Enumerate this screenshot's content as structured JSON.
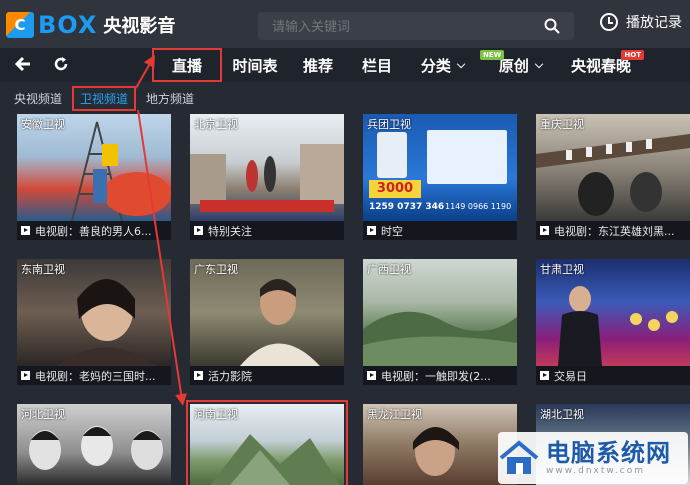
{
  "app": {
    "logo_mark": "C",
    "logo_box": "BOX",
    "logo_name": "央视影音"
  },
  "search": {
    "placeholder": "请输入关键词",
    "icon": "search-icon"
  },
  "history": {
    "label": "播放记录",
    "icon": "clock-icon"
  },
  "nav": {
    "back_icon": "back-arrow-icon",
    "refresh_icon": "refresh-icon",
    "items": [
      {
        "label": "直播",
        "active": true
      },
      {
        "label": "时间表"
      },
      {
        "label": "推荐"
      },
      {
        "label": "栏目"
      },
      {
        "label": "分类",
        "dropdown": true
      },
      {
        "label": "原创",
        "dropdown": true,
        "badge": "NEW"
      },
      {
        "label": "央视春晚",
        "badge": "HOT"
      }
    ]
  },
  "subtabs": [
    {
      "label": "央视频道"
    },
    {
      "label": "卫视频道",
      "active": true
    },
    {
      "label": "地方频道"
    }
  ],
  "channels": [
    {
      "name": "安徽卫视",
      "caption": "电视剧：善良的男人6..."
    },
    {
      "name": "北京卫视",
      "caption": "特别关注"
    },
    {
      "name": "兵团卫视",
      "caption": "时空",
      "overlay": {
        "price": "3000",
        "phone": "1259 0737 346",
        "phone2": "1149 0966 1190"
      }
    },
    {
      "name": "重庆卫视",
      "caption": "电视剧：东江英雄刘黑..."
    },
    {
      "name": "东南卫视",
      "caption": "电视剧：老妈的三国时..."
    },
    {
      "name": "广东卫视",
      "caption": "活力影院"
    },
    {
      "name": "广西卫视",
      "caption": "电视剧：一触即发(2..."
    },
    {
      "name": "甘肃卫视",
      "caption": "交易日"
    },
    {
      "name": "河北卫视",
      "caption": ""
    },
    {
      "name": "河南卫视",
      "caption": ""
    },
    {
      "name": "黑龙江卫视",
      "caption": ""
    },
    {
      "name": "湖北卫视",
      "caption": ""
    }
  ],
  "watermark": {
    "title": "电脑系统网",
    "sub": "www.dnxtw.com"
  },
  "colors": {
    "accent": "#25a4f5",
    "highlight": "#e53935",
    "topbar": "#30343d",
    "navbar": "#1f232b",
    "background": "#262a33"
  }
}
